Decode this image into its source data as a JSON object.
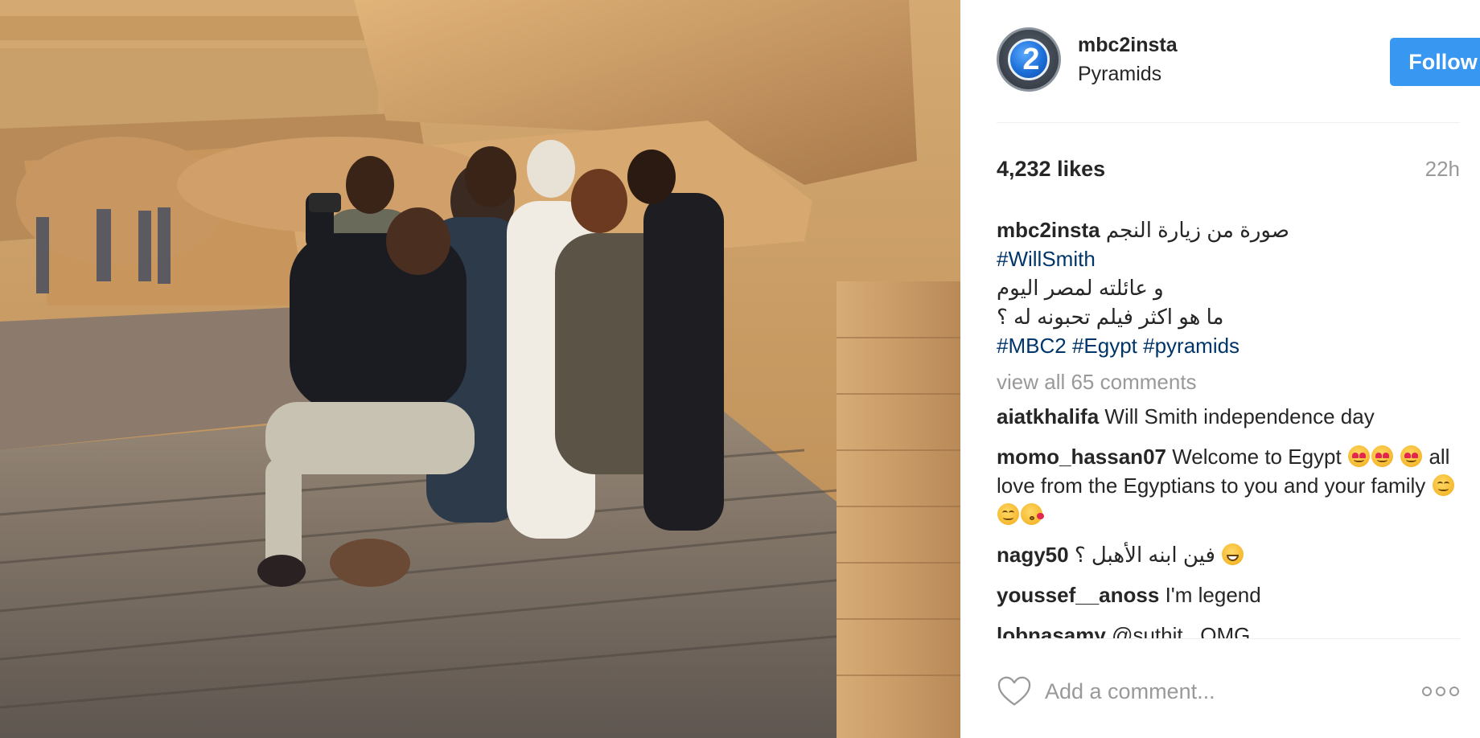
{
  "post": {
    "username": "mbc2insta",
    "location": "Pyramids",
    "follow_label": "Follow",
    "avatar_text": "2",
    "likes": "4,232 likes",
    "time_ago": "22h"
  },
  "caption": {
    "username": "mbc2insta",
    "line1": "صورة من زيارة النجم",
    "tag_willsmith": "#WillSmith",
    "line2": "و عائلته لمصر اليوم",
    "line3": "ما هو اكثر فيلم تحبونه له ؟",
    "tag_mbc2": "#MBC2",
    "tag_egypt": "#Egypt",
    "tag_pyramids": "#pyramids"
  },
  "view_all": "view all 65 comments",
  "comments": [
    {
      "user": "aiatkhalifa",
      "text": "Will Smith independence day"
    },
    {
      "user": "momo_hassan07",
      "text_a": "Welcome to Egypt",
      "text_b": "all love from the Egyptians to you and your family"
    },
    {
      "user": "nagy50",
      "text": "فين ابنه الأهبل ؟"
    },
    {
      "user": "youssef__anoss",
      "text": "I'm legend"
    },
    {
      "user": "lobnasamy",
      "text": "@suthit_ OMG"
    }
  ],
  "comment_input": {
    "placeholder": "Add a comment..."
  },
  "icons": {
    "like": "heart-outline-icon",
    "more": "more-options-icon"
  },
  "colors": {
    "follow": "#3897f0",
    "hashtag": "#003569",
    "muted": "#999999"
  }
}
